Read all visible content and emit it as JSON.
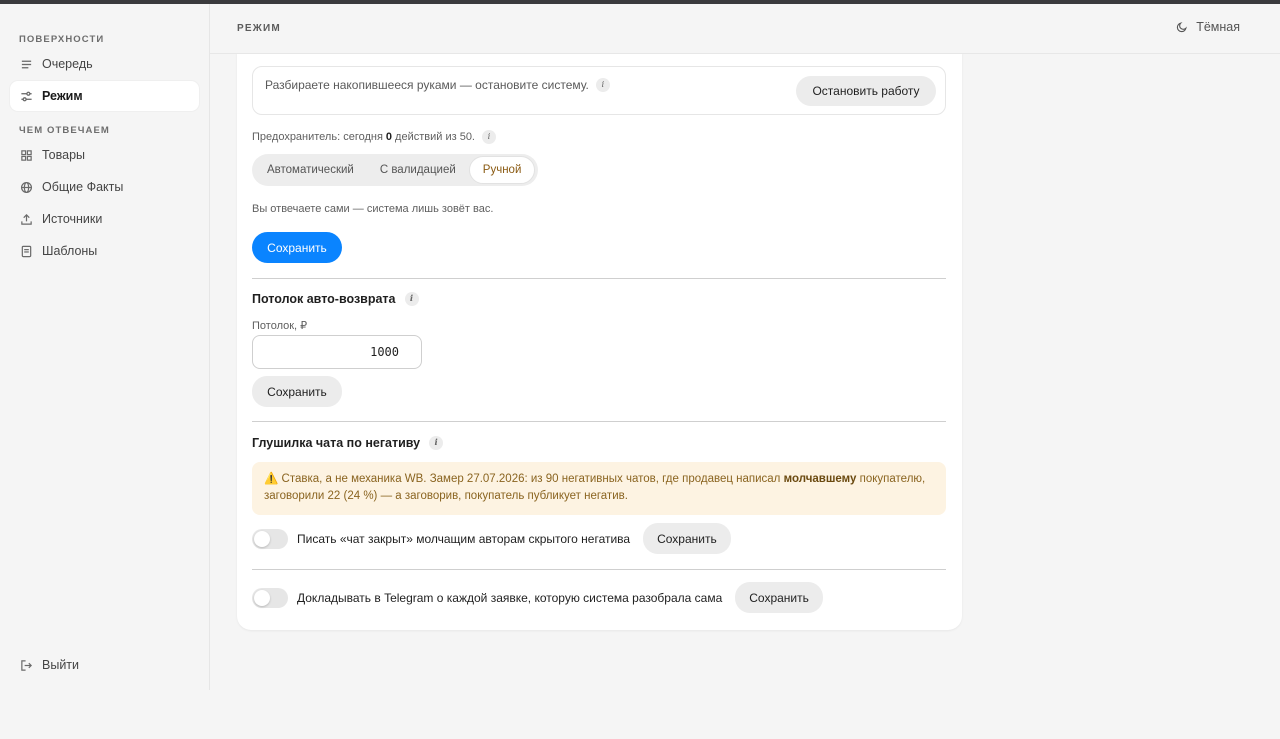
{
  "sidebar": {
    "section1": "ПОВЕРХНОСТИ",
    "items1": [
      {
        "label": "Очередь",
        "icon": "list-icon"
      },
      {
        "label": "Режим",
        "icon": "sliders-icon"
      }
    ],
    "section2": "ЧЕМ ОТВЕЧАЕМ",
    "items2": [
      {
        "label": "Товары",
        "icon": "grid-icon"
      },
      {
        "label": "Общие Факты",
        "icon": "globe-icon"
      },
      {
        "label": "Источники",
        "icon": "upload-icon"
      },
      {
        "label": "Шаблоны",
        "icon": "document-icon"
      }
    ],
    "logout": "Выйти"
  },
  "header": {
    "title": "РЕЖИМ",
    "theme": "Тёмная"
  },
  "mode": {
    "stop_text": "Разбираете накопившееся руками — остановите систему.",
    "stop_button": "Остановить работу",
    "fuse_prefix": "Предохранитель: сегодня",
    "fuse_count": "0",
    "fuse_suffix": "действий из 50.",
    "options": [
      "Автоматический",
      "С валидацией",
      "Ручной"
    ],
    "selected": "Ручной",
    "description": "Вы отвечаете сами — система лишь зовёт вас.",
    "save": "Сохранить"
  },
  "refund": {
    "title": "Потолок авто-возврата",
    "field_label": "Потолок, ₽",
    "value": "1000",
    "save": "Сохранить"
  },
  "mute": {
    "title": "Глушилка чата по негативу",
    "warn_part1": "⚠️ Ставка, а не механика WB. Замер 27.07.2026: из 90 негативных чатов, где продавец написал",
    "warn_bold": "молчавшему",
    "warn_part2": "покупателю, заговорили 22 (24 %) — а заговорив, покупатель публикует негатив.",
    "toggle_label": "Писать «чат закрыт» молчащим авторам скрытого негатива",
    "save": "Сохранить"
  },
  "telegram": {
    "toggle_label": "Докладывать в Telegram о каждой заявке, которую система разобрала сама",
    "save": "Сохранить"
  }
}
